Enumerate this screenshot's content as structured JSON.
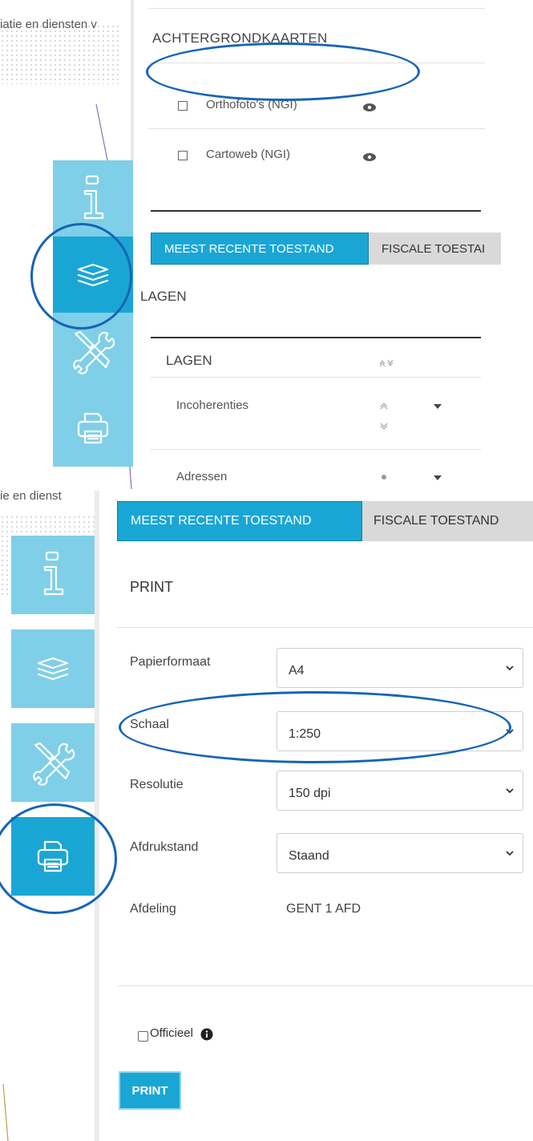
{
  "top": {
    "map_text": "iatie en diensten v",
    "background_maps_title": "ACHTERGRONDKAARTEN",
    "background_maps": [
      {
        "label": "Orthofoto's (NGI)"
      },
      {
        "label": "Cartoweb (NGI)"
      }
    ],
    "tabs": [
      {
        "label": "MEEST RECENTE TOESTAND",
        "active": true
      },
      {
        "label": "FISCALE TOESTAI",
        "active": false
      }
    ],
    "section_title": "LAGEN",
    "layers_header": "LAGEN",
    "layers": [
      {
        "label": "Incoherenties"
      },
      {
        "label": "Adressen"
      }
    ],
    "tools": [
      "info-icon",
      "layers-icon",
      "tools-icon",
      "printer-icon"
    ]
  },
  "bottom": {
    "map_text": "ie en dienst",
    "tabs": [
      {
        "label": "MEEST RECENTE TOESTAND",
        "active": true
      },
      {
        "label": "FISCALE TOESTAND",
        "active": false
      }
    ],
    "print_title": "PRINT",
    "fields": [
      {
        "label": "Papierformaat",
        "value": "A4"
      },
      {
        "label": "Schaal",
        "value": "1:250"
      },
      {
        "label": "Resolutie",
        "value": "150 dpi"
      },
      {
        "label": "Afdrukstand",
        "value": "Staand"
      }
    ],
    "afdeling_label": "Afdeling",
    "afdeling_value": "GENT 1 AFD",
    "officieel_label": "Officieel",
    "print_button": "PRINT",
    "tools": [
      "info-icon",
      "layers-icon",
      "tools-icon",
      "printer-icon"
    ]
  },
  "colors": {
    "accent": "#1aa6d5",
    "tile": "#7fcfe8",
    "highlight_ellipse": "#1565b5",
    "inactive_tab": "#d9d9d9"
  }
}
